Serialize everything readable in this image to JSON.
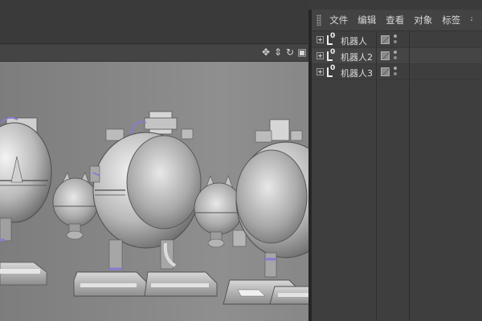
{
  "object_manager": {
    "menu": [
      "文件",
      "编辑",
      "查看",
      "对象",
      "标签",
      "书"
    ],
    "objects": [
      {
        "name": "机器人"
      },
      {
        "name": "机器人2"
      },
      {
        "name": "机器人3"
      }
    ]
  },
  "viewport": {
    "nav_icons": [
      "move-view-icon",
      "zoom-view-icon",
      "rotate-view-icon",
      "toggle-view-icon"
    ],
    "background_color": "#888888"
  },
  "colors": {
    "panel_bg": "#3e3e3e",
    "menubar_bg": "#434343",
    "text": "#d8d8d8"
  }
}
